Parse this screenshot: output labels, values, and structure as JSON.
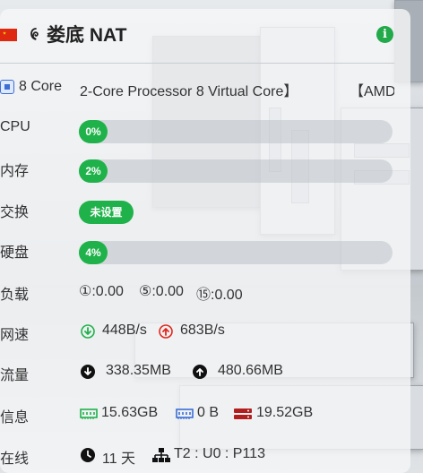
{
  "header": {
    "title": "娄底 NAT",
    "flag": "china-flag",
    "os_icon": "linux-icon",
    "info_icon": "info-icon"
  },
  "cpu": {
    "core_count": "8 Core",
    "model": "2-Core Processor 8 Virtual Core】",
    "vendor": "【AMD"
  },
  "rows": {
    "cpu": {
      "label": "CPU",
      "value": "0%",
      "fill_percent": 0
    },
    "memory": {
      "label": "内存",
      "value": "2%",
      "fill_percent": 2
    },
    "swap": {
      "label": "交换",
      "value": "未设置"
    },
    "disk": {
      "label": "硬盘",
      "value": "4%",
      "fill_percent": 4
    },
    "load": {
      "label": "负载",
      "load1": "①:0.00",
      "load5": "⑤:0.00",
      "load15": "⑮:0.00"
    },
    "netspeed": {
      "label": "网速",
      "down": "448B/s",
      "up": "683B/s"
    },
    "traffic": {
      "label": "流量",
      "down": "338.35MB",
      "up": "480.66MB"
    },
    "info": {
      "label": "信息",
      "memory_total": "15.63GB",
      "swap_total": "0 B",
      "disk_total": "19.52GB"
    },
    "online": {
      "label": "在线",
      "uptime": "11 天",
      "connections": "T2 : U0 : P113"
    }
  },
  "colors": {
    "green": "#1fb24a",
    "red": "#e0281c",
    "blue": "#3b6fd6",
    "dark_red": "#b01e1e"
  }
}
